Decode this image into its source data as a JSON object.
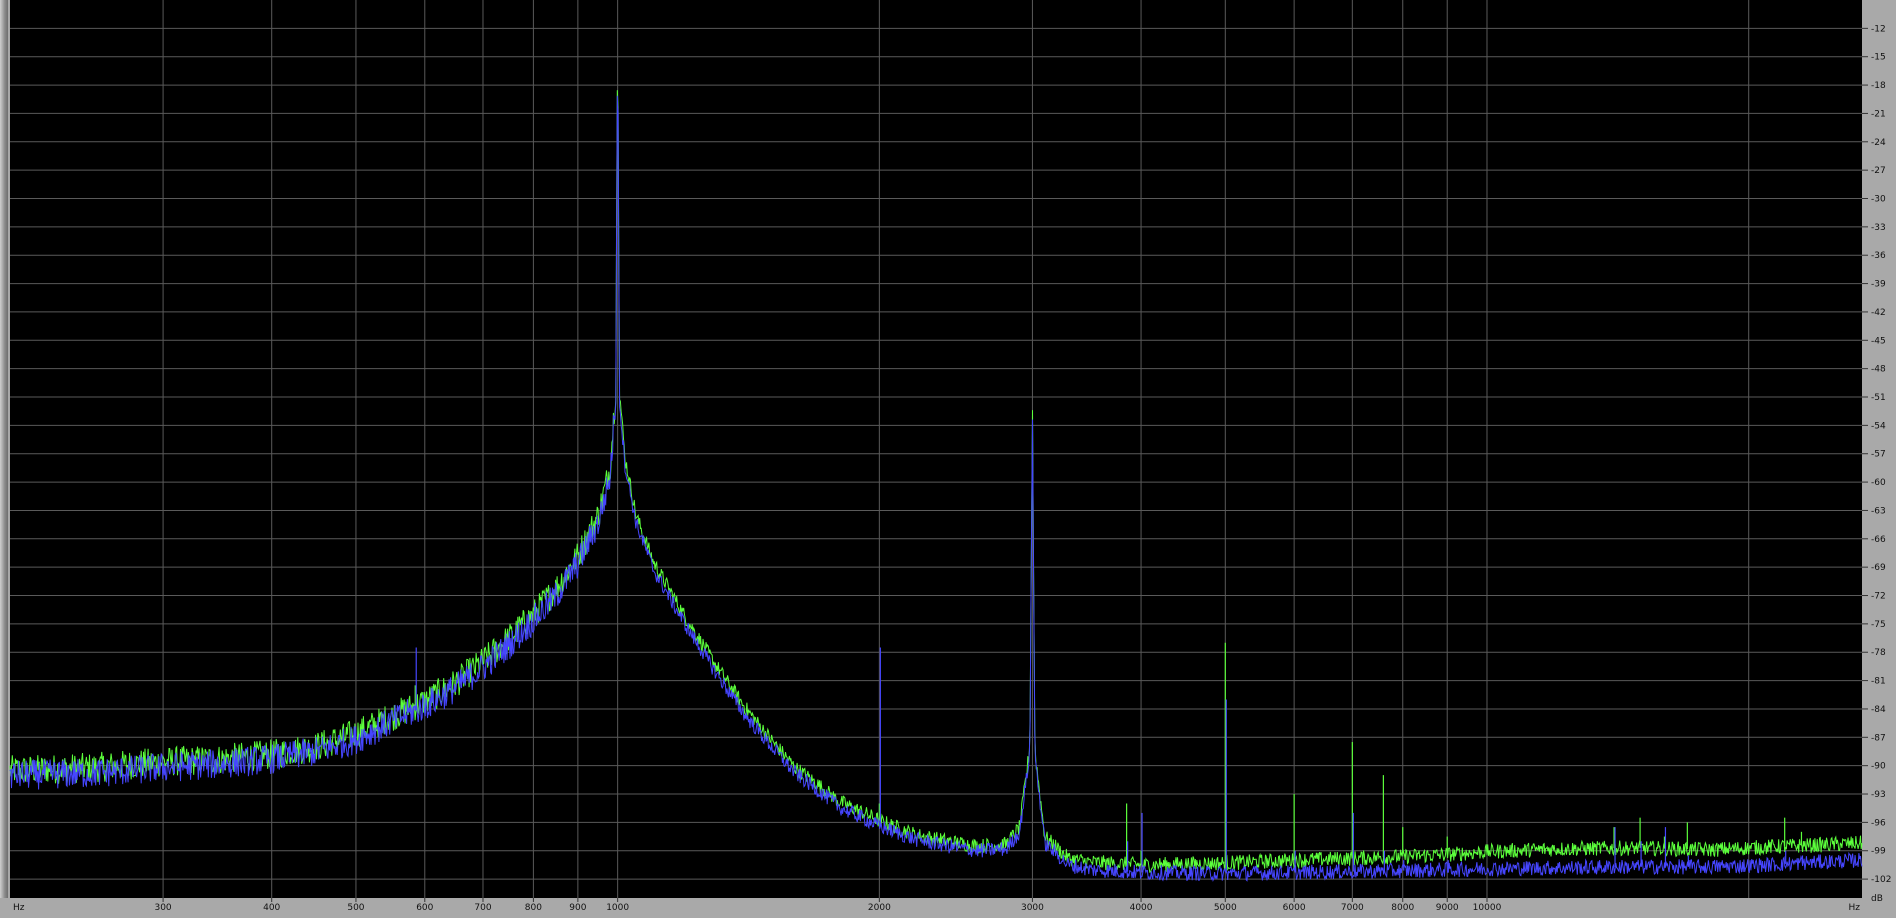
{
  "chart_data": {
    "type": "line",
    "title": "",
    "xlabel": "",
    "ylabel": "",
    "x_unit_left": "Hz",
    "x_unit_right": "Hz",
    "y_unit": "dB",
    "x_scale": "log",
    "xlim": [
      200,
      27000
    ],
    "ylim": [
      -104,
      -9
    ],
    "grid": true,
    "legend": "none",
    "x_ticks": [
      {
        "value": 300,
        "label": "300"
      },
      {
        "value": 400,
        "label": "400"
      },
      {
        "value": 500,
        "label": "500"
      },
      {
        "value": 600,
        "label": "600"
      },
      {
        "value": 700,
        "label": "700"
      },
      {
        "value": 800,
        "label": "800"
      },
      {
        "value": 900,
        "label": "900"
      },
      {
        "value": 1000,
        "label": "1000"
      },
      {
        "value": 2000,
        "label": "2000"
      },
      {
        "value": 3000,
        "label": "3000"
      },
      {
        "value": 4000,
        "label": "4000"
      },
      {
        "value": 5000,
        "label": "5000"
      },
      {
        "value": 6000,
        "label": "6000"
      },
      {
        "value": 7000,
        "label": "7000"
      },
      {
        "value": 8000,
        "label": "8000"
      },
      {
        "value": 9000,
        "label": "9000"
      },
      {
        "value": 10000,
        "label": "10000"
      }
    ],
    "y_ticks": [
      -12,
      -15,
      -18,
      -21,
      -24,
      -27,
      -30,
      -33,
      -36,
      -39,
      -42,
      -45,
      -48,
      -51,
      -54,
      -57,
      -60,
      -63,
      -66,
      -69,
      -72,
      -75,
      -78,
      -81,
      -84,
      -87,
      -90,
      -93,
      -96,
      -99,
      -102
    ],
    "colors": {
      "background": "#000000",
      "grid": "#5a5a5a",
      "series_green": "#5cff3c",
      "series_blue": "#4646ff"
    },
    "series": [
      {
        "color": "#5cff3c",
        "x": [
          200,
          250,
          300,
          350,
          400,
          450,
          500,
          550,
          600,
          650,
          700,
          750,
          800,
          850,
          900,
          950,
          980,
          995,
          1000,
          1005,
          1020,
          1050,
          1100,
          1200,
          1300,
          1400,
          1500,
          1600,
          1700,
          1800,
          1900,
          2000,
          2200,
          2400,
          2600,
          2800,
          2900,
          2980,
          3000,
          3020,
          3100,
          3300,
          3500,
          4000,
          5000,
          6000,
          7000,
          8000,
          9000,
          10000,
          12000,
          15000,
          18000,
          21000,
          24000,
          27000
        ],
        "y": [
          -90.5,
          -90.2,
          -89.6,
          -89.3,
          -88.8,
          -88.0,
          -86.6,
          -84.8,
          -83.2,
          -81.3,
          -79.0,
          -76.5,
          -74.0,
          -71.2,
          -67.8,
          -63.5,
          -58.5,
          -50.0,
          -11.5,
          -50.5,
          -57.5,
          -63.5,
          -68.5,
          -74.5,
          -79.5,
          -83.8,
          -87.2,
          -90.2,
          -92.0,
          -93.8,
          -94.8,
          -95.8,
          -97.3,
          -98.0,
          -98.5,
          -98.3,
          -96.5,
          -88.0,
          -52.0,
          -88.5,
          -97.5,
          -99.8,
          -100.2,
          -100.5,
          -100.3,
          -100.0,
          -99.8,
          -99.6,
          -99.4,
          -99.1,
          -98.8,
          -98.7,
          -98.9,
          -98.6,
          -98.4,
          -98.2
        ]
      },
      {
        "color": "#4646ff",
        "x": [
          200,
          250,
          300,
          350,
          400,
          450,
          500,
          550,
          600,
          650,
          700,
          750,
          800,
          850,
          900,
          950,
          980,
          995,
          1000,
          1005,
          1020,
          1050,
          1100,
          1200,
          1300,
          1400,
          1500,
          1600,
          1700,
          1800,
          1900,
          2000,
          2200,
          2400,
          2600,
          2800,
          2900,
          2980,
          3000,
          3020,
          3100,
          3300,
          3500,
          4000,
          5000,
          6000,
          7000,
          8000,
          9000,
          10000,
          12000,
          15000,
          18000,
          21000,
          24000,
          27000
        ],
        "y": [
          -91.0,
          -90.8,
          -90.2,
          -89.8,
          -89.3,
          -88.5,
          -87.2,
          -85.3,
          -83.7,
          -81.8,
          -79.6,
          -77.2,
          -74.6,
          -72.0,
          -68.6,
          -64.3,
          -59.5,
          -51.0,
          -12.0,
          -51.5,
          -58.3,
          -64.3,
          -69.3,
          -75.3,
          -80.3,
          -84.6,
          -87.9,
          -90.8,
          -92.6,
          -94.4,
          -95.4,
          -96.4,
          -97.8,
          -98.5,
          -99.0,
          -98.8,
          -97.0,
          -88.5,
          -53.0,
          -89.0,
          -98.2,
          -100.5,
          -101.0,
          -101.3,
          -101.4,
          -101.3,
          -101.2,
          -101.1,
          -101.0,
          -100.9,
          -100.8,
          -100.7,
          -100.7,
          -100.5,
          -100.2,
          -100.0
        ]
      }
    ],
    "spikes": [
      {
        "x": 585,
        "green": -81.5,
        "blue": -77.5
      },
      {
        "x": 2000,
        "green": -94.0,
        "blue": -77.5
      },
      {
        "x": 3850,
        "green": -94.0,
        "blue": -98.0
      },
      {
        "x": 4000,
        "green": -99.0,
        "blue": -95.0
      },
      {
        "x": 5000,
        "green": -77.0,
        "blue": -83.0
      },
      {
        "x": 6000,
        "green": -93.0,
        "blue": -99.0
      },
      {
        "x": 7000,
        "green": -87.5,
        "blue": -95.0
      },
      {
        "x": 7600,
        "green": -91.0,
        "blue": -99.0
      },
      {
        "x": 8000,
        "green": -96.5,
        "blue": -100.0
      },
      {
        "x": 9000,
        "green": -97.5,
        "blue": -100.0
      },
      {
        "x": 14000,
        "green": -96.5,
        "blue": -96.5
      },
      {
        "x": 15000,
        "green": -95.5,
        "blue": -98.0
      },
      {
        "x": 16000,
        "green": -97.5,
        "blue": -96.5
      },
      {
        "x": 17000,
        "green": -96.0,
        "blue": -99.5
      },
      {
        "x": 22000,
        "green": -95.5,
        "blue": -99.0
      },
      {
        "x": 23000,
        "green": -97.0,
        "blue": -99.5
      }
    ]
  }
}
